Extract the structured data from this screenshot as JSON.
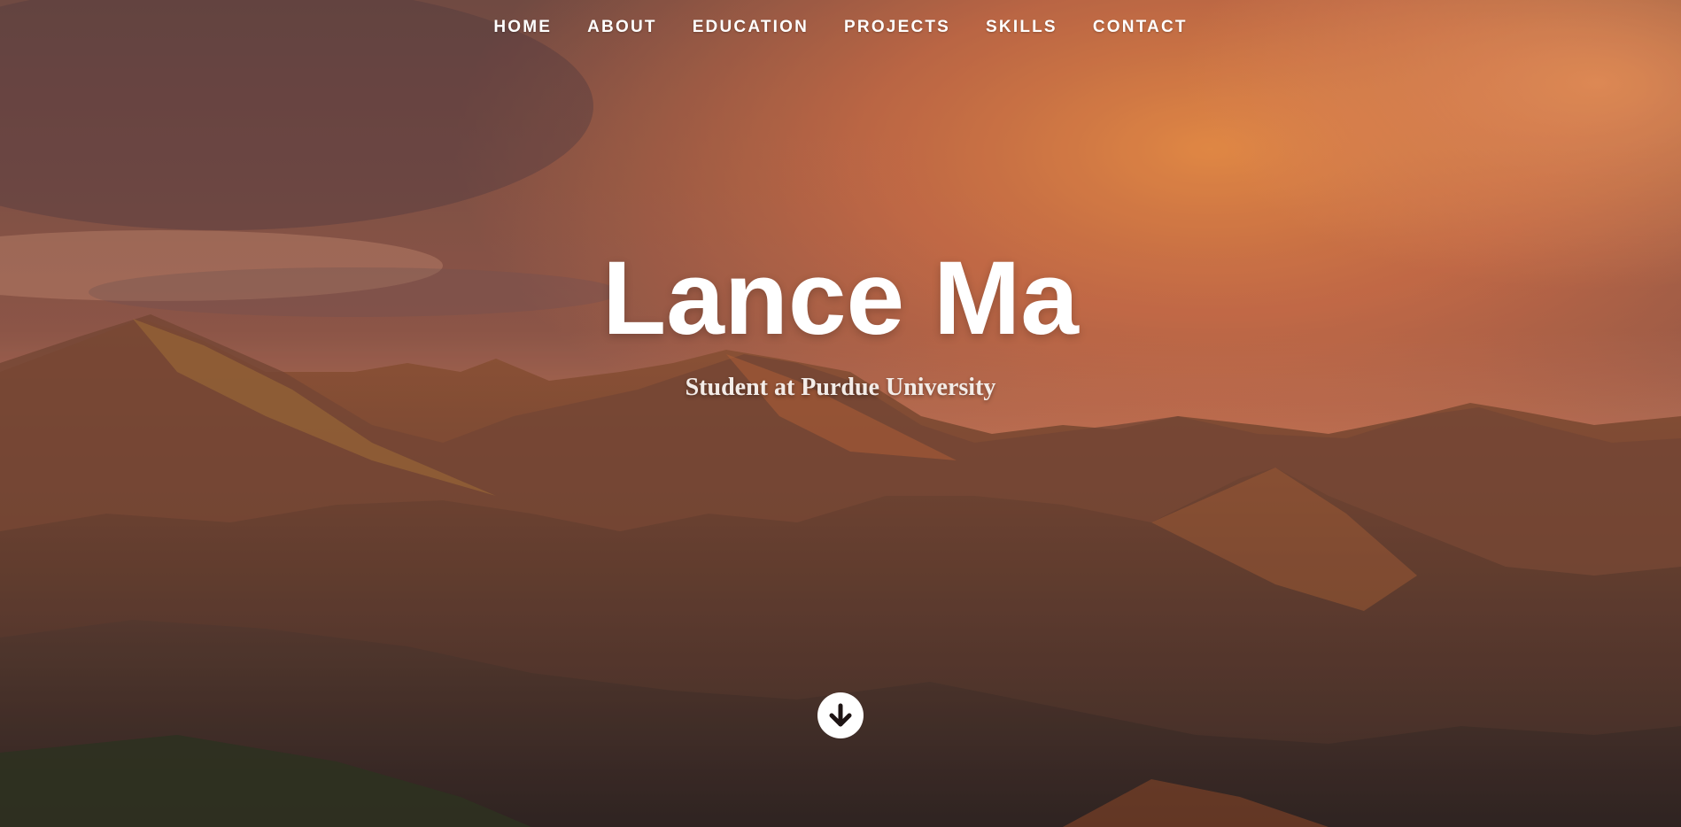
{
  "nav": {
    "items": [
      {
        "label": "HOME"
      },
      {
        "label": "ABOUT"
      },
      {
        "label": "EDUCATION"
      },
      {
        "label": "PROJECTS"
      },
      {
        "label": "SKILLS"
      },
      {
        "label": "CONTACT"
      }
    ]
  },
  "hero": {
    "name": "Lance Ma",
    "tagline": "Student at Purdue University",
    "background_image": "orange sunset clouds over forested mountain ranges",
    "scroll_icon": "arrow-down-circle-icon"
  },
  "colors": {
    "text": "#ffffff",
    "sky_orange": "#f0894d",
    "mountain_dark": "#3e2d29"
  }
}
